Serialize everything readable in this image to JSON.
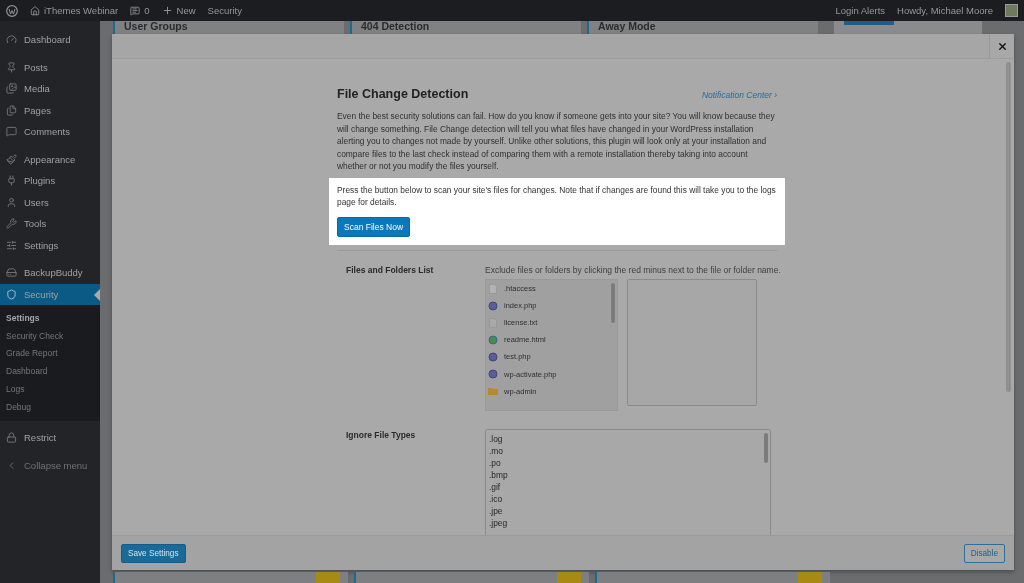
{
  "admin_bar": {
    "site_name": "iThemes Webinar",
    "comments_count": "0",
    "new_label": "New",
    "plugin_menu": "Security",
    "right_items": [
      "Login Alerts"
    ],
    "greeting": "Howdy, Michael Moore"
  },
  "sidebar": {
    "groups": [
      {
        "items": [
          {
            "label": "Dashboard",
            "selected": false
          }
        ]
      },
      {
        "items": [
          {
            "label": "Posts",
            "selected": false
          },
          {
            "label": "Media",
            "selected": false
          },
          {
            "label": "Pages",
            "selected": false
          },
          {
            "label": "Comments",
            "selected": false
          }
        ]
      },
      {
        "items": [
          {
            "label": "Appearance",
            "selected": false
          },
          {
            "label": "Plugins",
            "selected": false
          },
          {
            "label": "Users",
            "selected": false
          },
          {
            "label": "Tools",
            "selected": false
          },
          {
            "label": "Settings",
            "selected": false
          }
        ]
      },
      {
        "items": [
          {
            "label": "BackupBuddy",
            "selected": false
          },
          {
            "label": "Security",
            "selected": true,
            "children": [
              {
                "label": "Settings",
                "selected": true
              },
              {
                "label": "Security Check",
                "selected": false
              },
              {
                "label": "Grade Report",
                "selected": false
              },
              {
                "label": "Dashboard",
                "selected": false
              },
              {
                "label": "Logs",
                "selected": false
              },
              {
                "label": "Debug",
                "selected": false
              }
            ]
          }
        ]
      },
      {
        "items": [
          {
            "label": "Restrict",
            "selected": false
          }
        ]
      }
    ],
    "collapse_label": "Collapse menu"
  },
  "background_cards": [
    {
      "title": "User Groups"
    },
    {
      "title": "404 Detection"
    },
    {
      "title": "Away Mode"
    }
  ],
  "modal": {
    "title": "File Change Detection",
    "link": "Notification Center ›",
    "intro": "Even the best security solutions can fail. How do you know if someone gets into your site? You will know because they will change something. File Change detection will tell you what files have changed in your WordPress installation alerting you to changes not made by yourself. Unlike other solutions, this plugin will look only at your installation and compare files to the last check instead of comparing them with a remote installation thereby taking into account whether or not you modify the files yourself.",
    "scan_note": "Press the button below to scan your site's files for changes. Note that if changes are found this will take you to the logs page for details.",
    "scan_button": "Scan Files Now",
    "fields": [
      {
        "kind": "file_tree",
        "label": "Files and Folders List",
        "description": "Exclude files or folders by clicking the red minus next to the file or folder name.",
        "files": [
          {
            "name": ".htaccess",
            "kind": "blank"
          },
          {
            "name": "index.php",
            "kind": "php"
          },
          {
            "name": "license.txt",
            "kind": "text"
          },
          {
            "name": "readme.html",
            "kind": "html"
          },
          {
            "name": "test.php",
            "kind": "php"
          },
          {
            "name": "wp-activate.php",
            "kind": "php"
          },
          {
            "name": "wp-admin",
            "kind": "folder"
          }
        ]
      },
      {
        "kind": "textarea",
        "label": "Ignore File Types",
        "lines": [
          ".log",
          ".mo",
          ".po",
          ".bmp",
          ".gif",
          ".ico",
          ".jpe",
          ".jpeg"
        ]
      }
    ],
    "save_button": "Save Settings",
    "disable_button": "Disable"
  }
}
